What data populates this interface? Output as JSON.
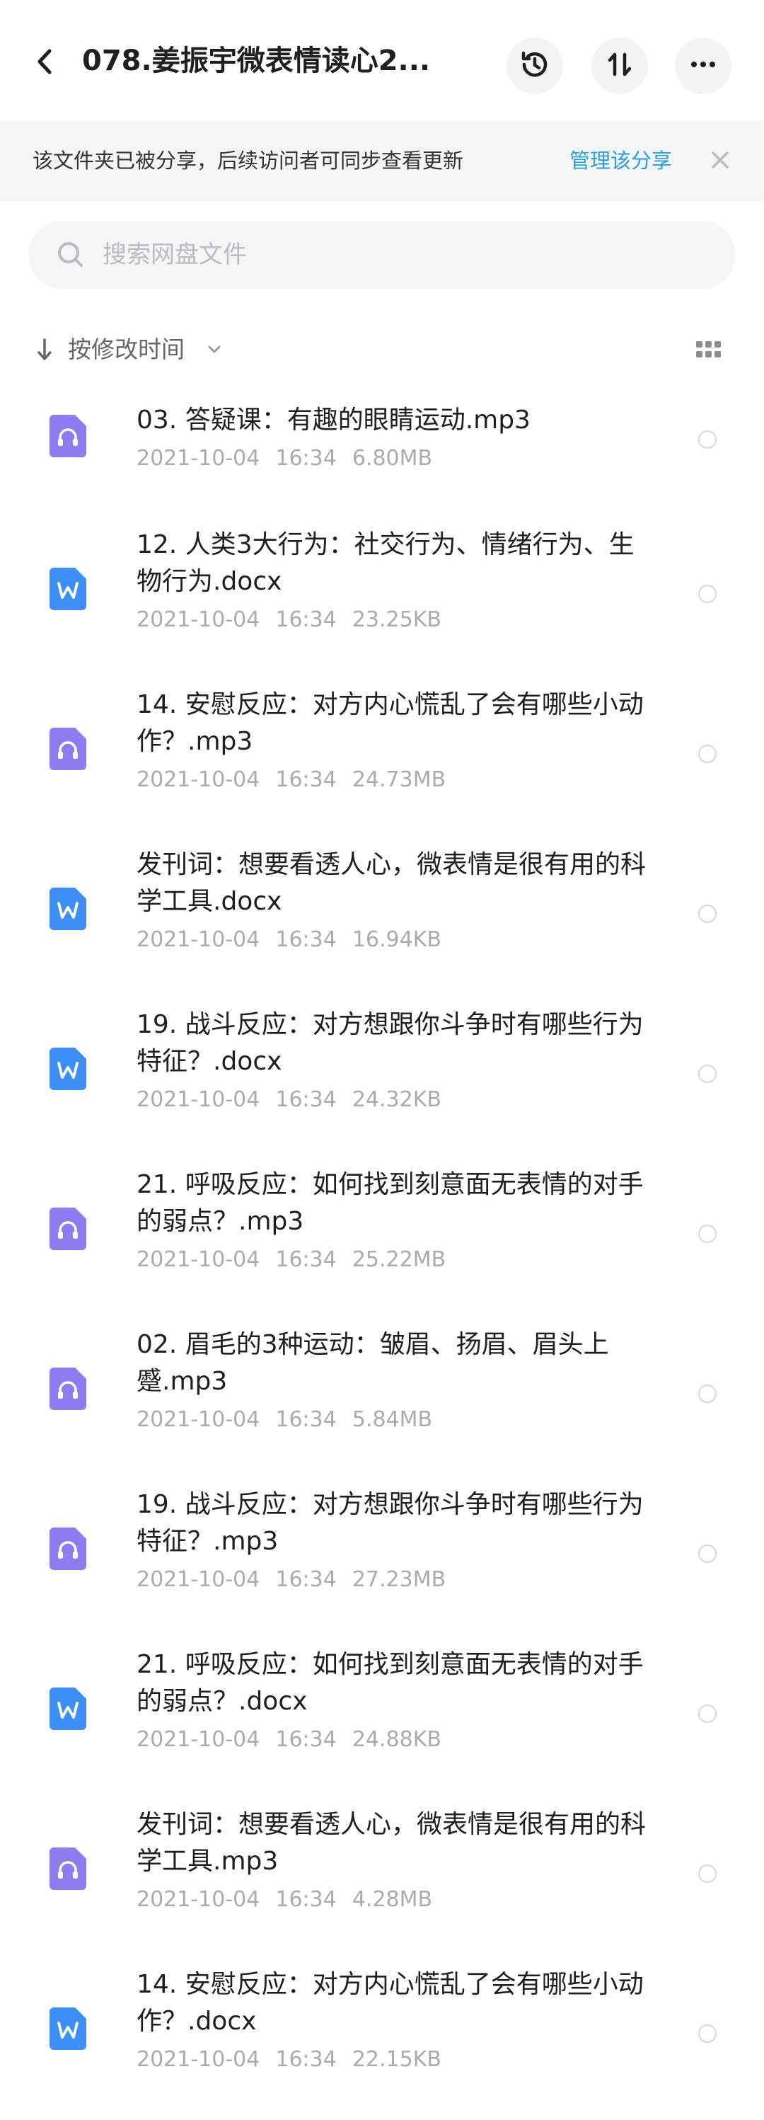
{
  "header": {
    "title": "078.姜振宇微表情读心2...",
    "back_icon": "back-arrow-icon",
    "history_icon": "history-icon",
    "sort_icon": "sort-icon",
    "more_icon": "more-icon"
  },
  "banner": {
    "text": "该文件夹已被分享，后续访问者可同步查看更新",
    "action": "管理该分享",
    "accent_color": "#2c9fd8"
  },
  "search": {
    "placeholder": "搜索网盘文件",
    "value": ""
  },
  "sort": {
    "label": "按修改时间"
  },
  "colors": {
    "audio_icon": "#8f7cf0",
    "doc_icon": "#3d8ff7",
    "meta_text": "#a8abb0"
  },
  "files": [
    {
      "name": "03. 答疑课：有趣的眼睛运动.mp3",
      "date": "2021-10-04",
      "time": "16:34",
      "size": "6.80MB",
      "type": "audio"
    },
    {
      "name": "12. 人类3大行为：社交行为、情绪行为、生物行为.docx",
      "date": "2021-10-04",
      "time": "16:34",
      "size": "23.25KB",
      "type": "doc"
    },
    {
      "name": "14. 安慰反应：对方内心慌乱了会有哪些小动作？.mp3",
      "date": "2021-10-04",
      "time": "16:34",
      "size": "24.73MB",
      "type": "audio"
    },
    {
      "name": "发刊词：想要看透人心，微表情是很有用的科学工具.docx",
      "date": "2021-10-04",
      "time": "16:34",
      "size": "16.94KB",
      "type": "doc"
    },
    {
      "name": "19. 战斗反应：对方想跟你斗争时有哪些行为特征？.docx",
      "date": "2021-10-04",
      "time": "16:34",
      "size": "24.32KB",
      "type": "doc"
    },
    {
      "name": "21. 呼吸反应：如何找到刻意面无表情的对手的弱点？.mp3",
      "date": "2021-10-04",
      "time": "16:34",
      "size": "25.22MB",
      "type": "audio"
    },
    {
      "name": "02. 眉毛的3种运动：皱眉、扬眉、眉头上蹙.mp3",
      "date": "2021-10-04",
      "time": "16:34",
      "size": "5.84MB",
      "type": "audio"
    },
    {
      "name": "19. 战斗反应：对方想跟你斗争时有哪些行为特征？.mp3",
      "date": "2021-10-04",
      "time": "16:34",
      "size": "27.23MB",
      "type": "audio"
    },
    {
      "name": "21. 呼吸反应：如何找到刻意面无表情的对手的弱点？.docx",
      "date": "2021-10-04",
      "time": "16:34",
      "size": "24.88KB",
      "type": "doc"
    },
    {
      "name": "发刊词：想要看透人心，微表情是很有用的科学工具.mp3",
      "date": "2021-10-04",
      "time": "16:34",
      "size": "4.28MB",
      "type": "audio"
    },
    {
      "name": "14. 安慰反应：对方内心慌乱了会有哪些小动作？.docx",
      "date": "2021-10-04",
      "time": "16:34",
      "size": "22.15KB",
      "type": "doc"
    }
  ]
}
